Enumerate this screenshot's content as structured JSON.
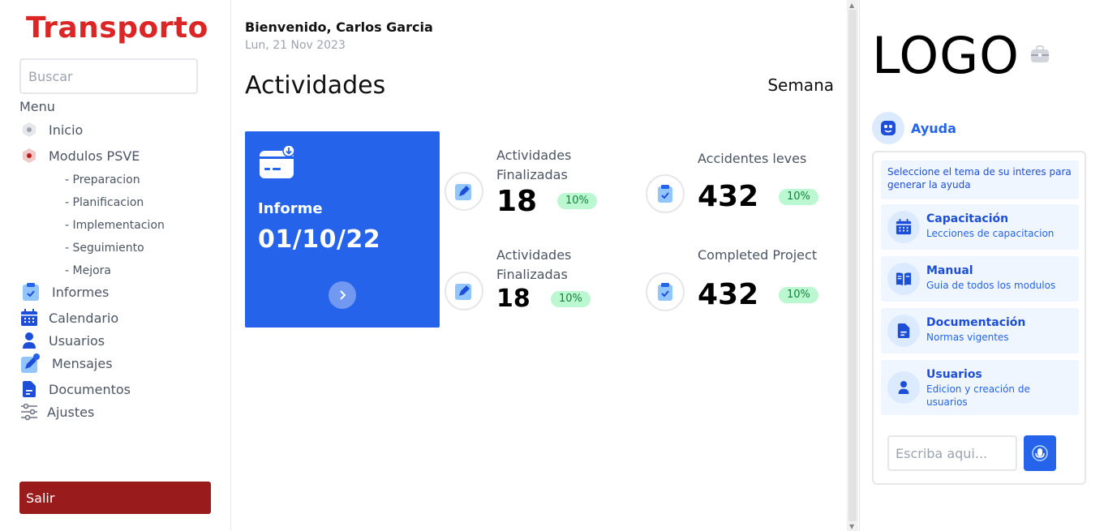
{
  "sidebar": {
    "brand": "Transporto",
    "search_placeholder": "Buscar",
    "menu_title": "Menu",
    "items": [
      {
        "label": "Inicio",
        "icon": "circle-icon"
      },
      {
        "label": "Modulos PSVE",
        "icon": "hexagon-icon"
      },
      {
        "label": "Informes",
        "icon": "clipboard-check-icon"
      },
      {
        "label": "Calendario",
        "icon": "calendar-icon"
      },
      {
        "label": "Usuarios",
        "icon": "user-icon"
      },
      {
        "label": "Mensajes",
        "icon": "edit-icon"
      },
      {
        "label": "Documentos",
        "icon": "document-icon"
      },
      {
        "label": "Ajustes",
        "icon": "sliders-icon"
      }
    ],
    "subitems": [
      "- Preparacion",
      "- Planificacion",
      "- Implementacion",
      "- Seguimiento",
      "- Mejora"
    ],
    "logout_label": "Salir"
  },
  "header": {
    "welcome": "Bienvenido, Carlos Garcia",
    "date": "Lun, 21 Nov 2023"
  },
  "main": {
    "title": "Actividades",
    "period": "Semana",
    "report": {
      "label": "Informe",
      "date": "01/10/22"
    },
    "stats": [
      {
        "label": "Actividades Finalizadas",
        "value": "18",
        "badge": "10%"
      },
      {
        "label": "Accidentes leves",
        "value": "432",
        "badge": "10%"
      },
      {
        "label": "Actividades Finalizadas",
        "value": "18",
        "badge": "10%"
      },
      {
        "label": "Completed Project",
        "value": "432",
        "badge": "10%"
      }
    ]
  },
  "right_panel": {
    "logo": "LOGO",
    "help_title": "Ayuda",
    "help_intro": "Seleccione el tema de su interes para generar la ayuda",
    "topics": [
      {
        "title": "Capacitación",
        "desc": "Lecciones de capacitacion",
        "icon": "calendar-icon"
      },
      {
        "title": "Manual",
        "desc": "Guia de todos los modulos",
        "icon": "book-icon"
      },
      {
        "title": "Documentación",
        "desc": "Normas vigentes",
        "icon": "document-icon"
      },
      {
        "title": "Usuarios",
        "desc": "Edicion y creación de usuarios",
        "icon": "user-icon"
      }
    ],
    "chat_placeholder": "Escriba aqui..."
  },
  "colors": {
    "brand": "#dc2626",
    "primary": "#2563eb",
    "logout": "#991b1b",
    "badge_bg": "#bbf7d0",
    "badge_text": "#15803d"
  }
}
